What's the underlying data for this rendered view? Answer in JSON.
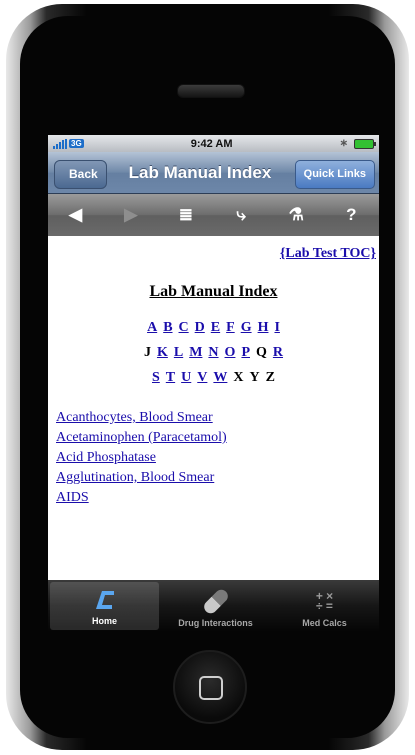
{
  "status_bar": {
    "time": "9:42 AM",
    "carrier": "3G"
  },
  "nav_bar": {
    "back_label": "Back",
    "title": "Lab Manual Index",
    "quick_links_label": "Quick Links"
  },
  "toolbar": {
    "back_glyph": "◀",
    "forward_glyph": "▶",
    "list_glyph": "≣",
    "vitals_glyph": "⤷",
    "lab_glyph": "⚗",
    "help_glyph": "?"
  },
  "content": {
    "toc_link": "{Lab Test TOC}",
    "heading": "Lab Manual Index",
    "letter_rows": [
      [
        {
          "t": "A",
          "link": true
        },
        {
          "t": "B",
          "link": true
        },
        {
          "t": "C",
          "link": true
        },
        {
          "t": "D",
          "link": true
        },
        {
          "t": "E",
          "link": true
        },
        {
          "t": "F",
          "link": true
        },
        {
          "t": "G",
          "link": true
        },
        {
          "t": "H",
          "link": true
        },
        {
          "t": "I",
          "link": true
        }
      ],
      [
        {
          "t": "J",
          "link": false
        },
        {
          "t": "K",
          "link": true
        },
        {
          "t": "L",
          "link": true
        },
        {
          "t": "M",
          "link": true
        },
        {
          "t": "N",
          "link": true
        },
        {
          "t": "O",
          "link": true
        },
        {
          "t": "P",
          "link": true
        },
        {
          "t": "Q",
          "link": false
        },
        {
          "t": "R",
          "link": true
        }
      ],
      [
        {
          "t": "S",
          "link": true
        },
        {
          "t": "T",
          "link": true
        },
        {
          "t": "U",
          "link": true
        },
        {
          "t": "V",
          "link": true
        },
        {
          "t": "W",
          "link": true
        },
        {
          "t": "X",
          "link": false
        },
        {
          "t": "Y",
          "link": false
        },
        {
          "t": "Z",
          "link": false
        }
      ]
    ],
    "entries": [
      "Acanthocytes, Blood Smear",
      "Acetaminophen (Paracetamol)",
      "Acid Phosphatase",
      "Agglutination, Blood Smear",
      "AIDS"
    ]
  },
  "tab_bar": {
    "tabs": [
      {
        "label": "Home",
        "icon": "home-icon"
      },
      {
        "label": "Drug Interactions",
        "icon": "pill-icon"
      },
      {
        "label": "Med Calcs",
        "icon": "calculator-icon"
      }
    ]
  },
  "colors": {
    "link": "#1a0dab",
    "nav_bar": "#6f88a8",
    "quick_links": "#4a7ac2",
    "tab_bar": "#161616"
  }
}
